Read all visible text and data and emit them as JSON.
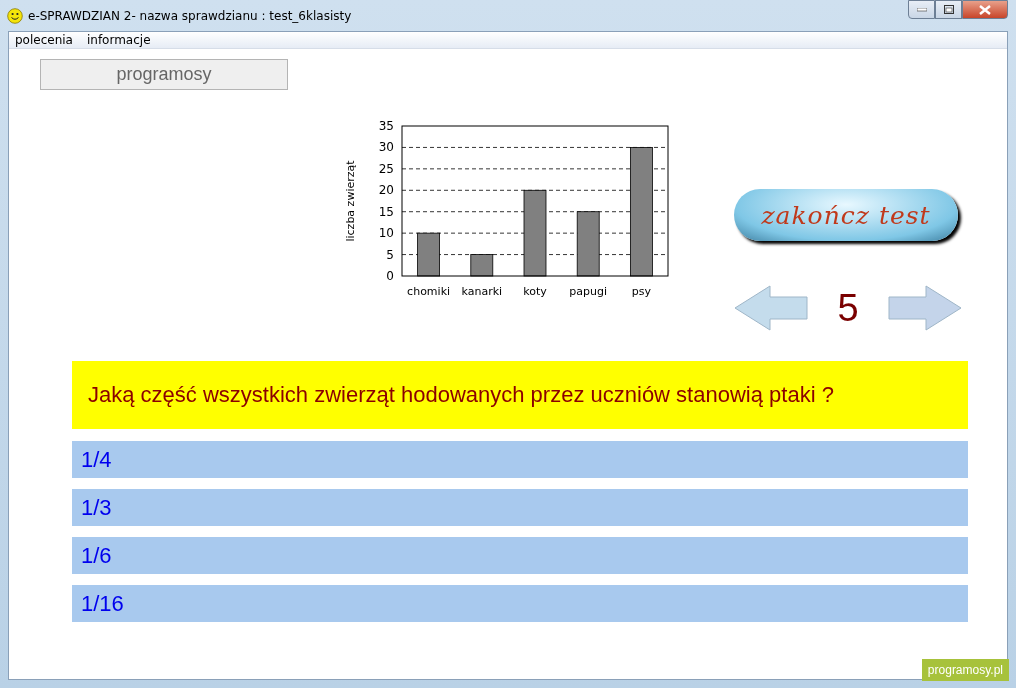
{
  "window": {
    "title": "e-SPRAWDZIAN 2- nazwa sprawdzianu : test_6klasisty"
  },
  "menu": [
    "polecenia",
    "informacje"
  ],
  "logo_button": "programosy",
  "chart": {
    "chart_data": {
      "type": "bar",
      "ylabel": "liczba  zwierząt",
      "categories": [
        "chomiki",
        "kanarki",
        "koty",
        "papugi",
        "psy"
      ],
      "values": [
        10,
        5,
        20,
        15,
        30
      ],
      "ylim": [
        0,
        35
      ],
      "grid": true,
      "yticks": [
        0,
        5,
        10,
        15,
        20,
        25,
        30,
        35
      ]
    }
  },
  "finish_button": "zakończ  test",
  "question_number": "5",
  "question": "Jaką część wszystkich zwierząt hodowanych przez uczniów stanowią ptaki ?",
  "answers": [
    "1/4",
    "1/3",
    "1/6",
    "1/16"
  ],
  "footer_badge": "programosy.pl"
}
